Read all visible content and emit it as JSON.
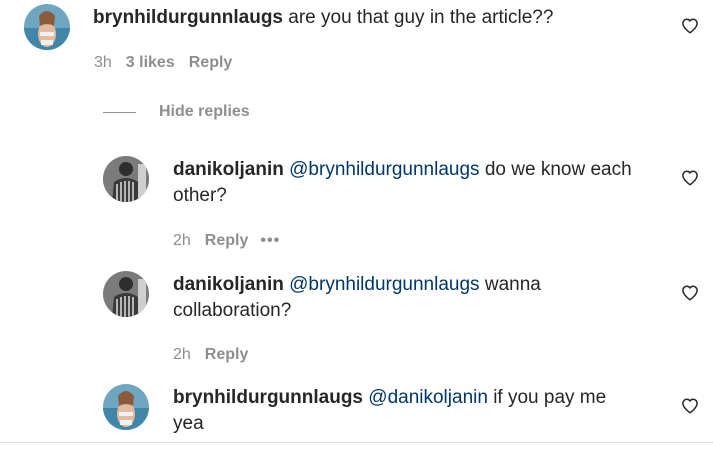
{
  "comments": [
    {
      "username": "brynhildurgunnlaugs",
      "text": "are you that guy in the article??",
      "time": "3h",
      "likes": "3 likes",
      "reply": "Reply",
      "avatar_icon": "avatar-photo-beach"
    }
  ],
  "replies_toggle": {
    "label": "Hide replies"
  },
  "replies": [
    {
      "username": "danikoljanin",
      "mention": "@brynhildurgunnlaugs",
      "text_line1": "do we know each",
      "text_line2": "other?",
      "time": "2h",
      "reply": "Reply",
      "more": "•••",
      "avatar_icon": "avatar-photo-man"
    },
    {
      "username": "danikoljanin",
      "mention": "@brynhildurgunnlaugs",
      "text_line1": "wanna",
      "text_line2": "collaboration?",
      "time": "2h",
      "reply": "Reply",
      "avatar_icon": "avatar-photo-man"
    },
    {
      "username": "brynhildurgunnlaugs",
      "mention": "@danikoljanin",
      "text_line1": "if you pay me",
      "text_line2": "yea",
      "avatar_icon": "avatar-photo-beach"
    }
  ],
  "icons": {
    "like": "heart-outline-icon"
  },
  "colors": {
    "text": "#262626",
    "secondary": "#8e8e8e",
    "mention": "#00376b",
    "divider": "#dbdbdb"
  }
}
